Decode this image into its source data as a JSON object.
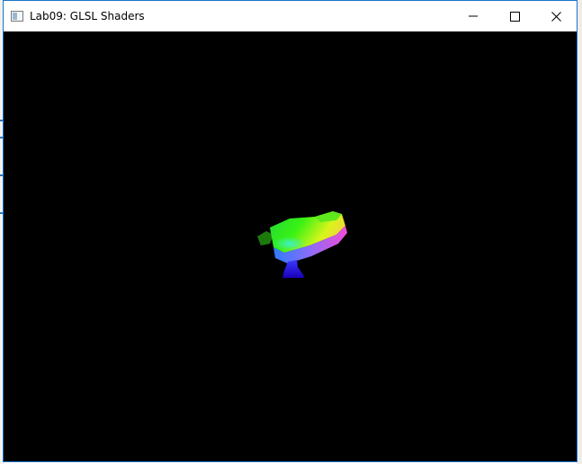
{
  "window": {
    "title": "Lab09: GLSL Shaders",
    "app_icon": "window-app-icon",
    "controls": {
      "minimize_icon": "minimize-icon",
      "maximize_icon": "maximize-icon",
      "close_icon": "close-icon"
    }
  },
  "viewport": {
    "background": "#000000",
    "model": "normal-shaded-teapot"
  },
  "colors": {
    "window_border": "#1a73c9",
    "titlebar": "#ffffff",
    "title_text": "#000000"
  }
}
